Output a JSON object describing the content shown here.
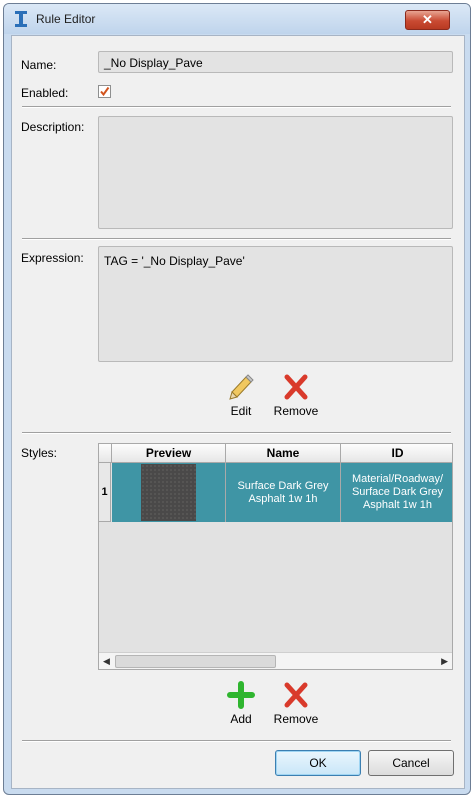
{
  "window": {
    "title": "Rule Editor",
    "close_symbol": "✕"
  },
  "form": {
    "name_label": "Name:",
    "name_value": "_No Display_Pave",
    "enabled_label": "Enabled:",
    "enabled_checked": true,
    "description_label": "Description:",
    "description_value": "",
    "expression_label": "Expression:",
    "expression_value": "TAG = '_No Display_Pave'"
  },
  "expression_actions": {
    "edit_label": "Edit",
    "remove_label": "Remove"
  },
  "styles": {
    "label": "Styles:",
    "columns": [
      "Preview",
      "Name",
      "ID"
    ],
    "rows": [
      {
        "index": "1",
        "name": "Surface Dark Grey Asphalt 1w 1h",
        "id": "Material/Roadway/ Surface Dark Grey Asphalt 1w 1h"
      }
    ],
    "selected_row_color": "#3f95a5",
    "add_label": "Add",
    "remove_label": "Remove"
  },
  "footer": {
    "ok_label": "OK",
    "cancel_label": "Cancel"
  },
  "colors": {
    "accent_red": "#d93a2b",
    "accent_green": "#2fb52f",
    "selection": "#3f95a5"
  }
}
